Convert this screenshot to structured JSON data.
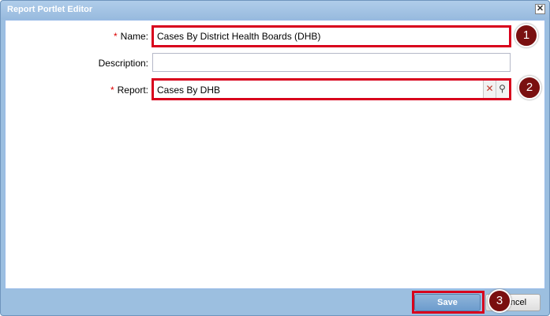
{
  "window": {
    "title": "Report Portlet Editor",
    "close_symbol": "✕"
  },
  "form": {
    "name": {
      "required_marker": "*",
      "label": "Name:",
      "value": "Cases By District Health Boards (DHB)"
    },
    "description": {
      "label": "Description:",
      "value": ""
    },
    "report": {
      "required_marker": "*",
      "label": "Report:",
      "value": "Cases By DHB",
      "clear_symbol": "✕",
      "search_symbol": "⚲"
    }
  },
  "footer": {
    "save_label": "Save",
    "cancel_label": "Cancel"
  },
  "callouts": [
    "1",
    "2",
    "3"
  ],
  "colors": {
    "highlight": "#d8001c",
    "callout": "#7a1010",
    "window_frame": "#9cbfe0",
    "required": "#dd0000"
  },
  "icons": {
    "close": "close-icon",
    "clear": "clear-icon",
    "search": "search-icon"
  }
}
